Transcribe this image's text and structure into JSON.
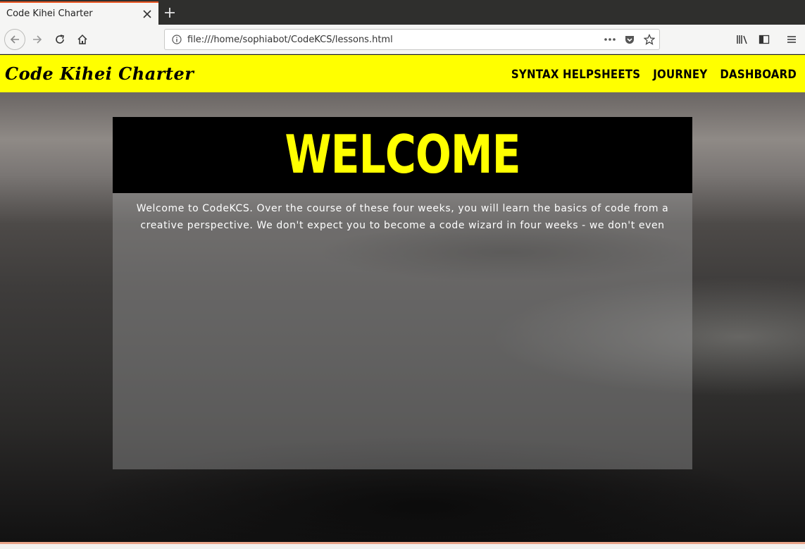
{
  "browser": {
    "tab_title": "Code Kihei Charter",
    "url": "file:///home/sophiabot/CodeKCS/lessons.html",
    "accent": "#e95420"
  },
  "site": {
    "logo": "Code Kihei Charter",
    "nav": [
      "SYNTAX HELPSHEETS",
      "JOURNEY",
      "DASHBOARD"
    ],
    "header_color": "#ffff00"
  },
  "main": {
    "title": "WELCOME",
    "body": "Welcome to CodeKCS. Over the course of these four weeks, you will learn the basics of code from a creative perspective. We don't expect you to become a code wizard in four weeks - we don't even"
  }
}
